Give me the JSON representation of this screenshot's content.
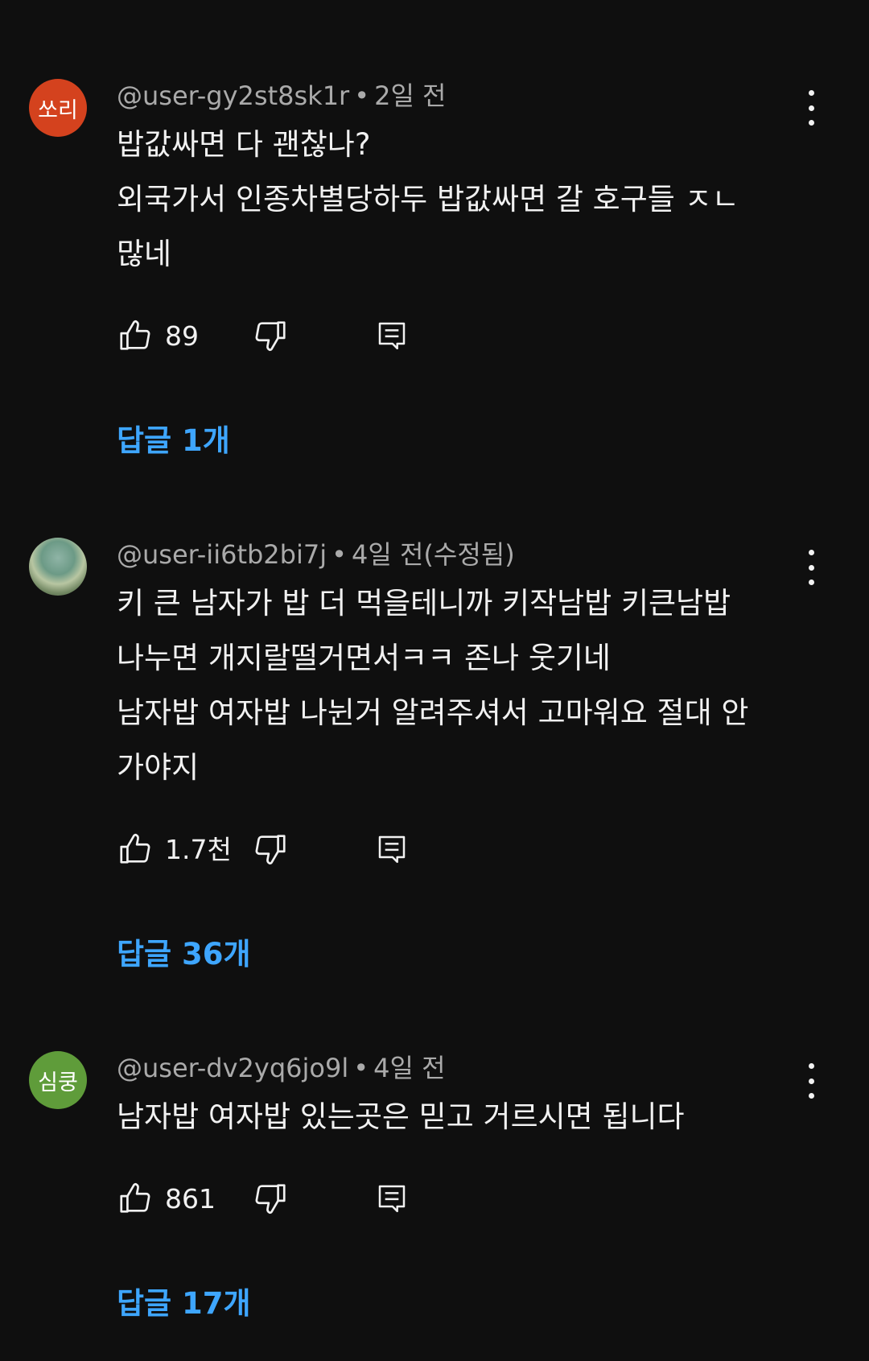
{
  "colors": {
    "background": "#0f0f0f",
    "text_primary": "#f1f1f1",
    "text_secondary": "#aaaaaa",
    "link": "#3ea6ff",
    "avatar_1": "#d4421e",
    "avatar_3": "#5f9c3a"
  },
  "comments": [
    {
      "avatar_text": "쏘리",
      "author": "@user-gy2st8sk1r",
      "time": "2일 전",
      "text": "밥값싸면 다 괜찮나?\n외국가서 인종차별당하두 밥값싸면 갈 호구들 ㅈㄴ\n많네",
      "likes": "89",
      "replies": "답글 1개",
      "icons": {
        "like": "thumbs-up-icon",
        "dislike": "thumbs-down-icon",
        "reply": "comment-icon",
        "more": "more-vert-icon"
      }
    },
    {
      "avatar_text": "",
      "author": "@user-ii6tb2bi7j",
      "time": "4일 전(수정됨)",
      "text": "키 큰 남자가 밥 더 먹을테니까 키작남밥 키큰남밥\n나누면 개지랄떨거면서ㅋㅋ 존나 웃기네\n남자밥 여자밥 나뉜거 알려주셔서 고마워요 절대 안\n가야지",
      "likes": "1.7천",
      "replies": "답글 36개",
      "icons": {
        "like": "thumbs-up-icon",
        "dislike": "thumbs-down-icon",
        "reply": "comment-icon",
        "more": "more-vert-icon"
      }
    },
    {
      "avatar_text": "심쿵",
      "author": "@user-dv2yq6jo9l",
      "time": "4일 전",
      "text": "남자밥 여자밥 있는곳은 믿고 거르시면 됩니다",
      "likes": "861",
      "replies": "답글 17개",
      "icons": {
        "like": "thumbs-up-icon",
        "dislike": "thumbs-down-icon",
        "reply": "comment-icon",
        "more": "more-vert-icon"
      }
    }
  ]
}
